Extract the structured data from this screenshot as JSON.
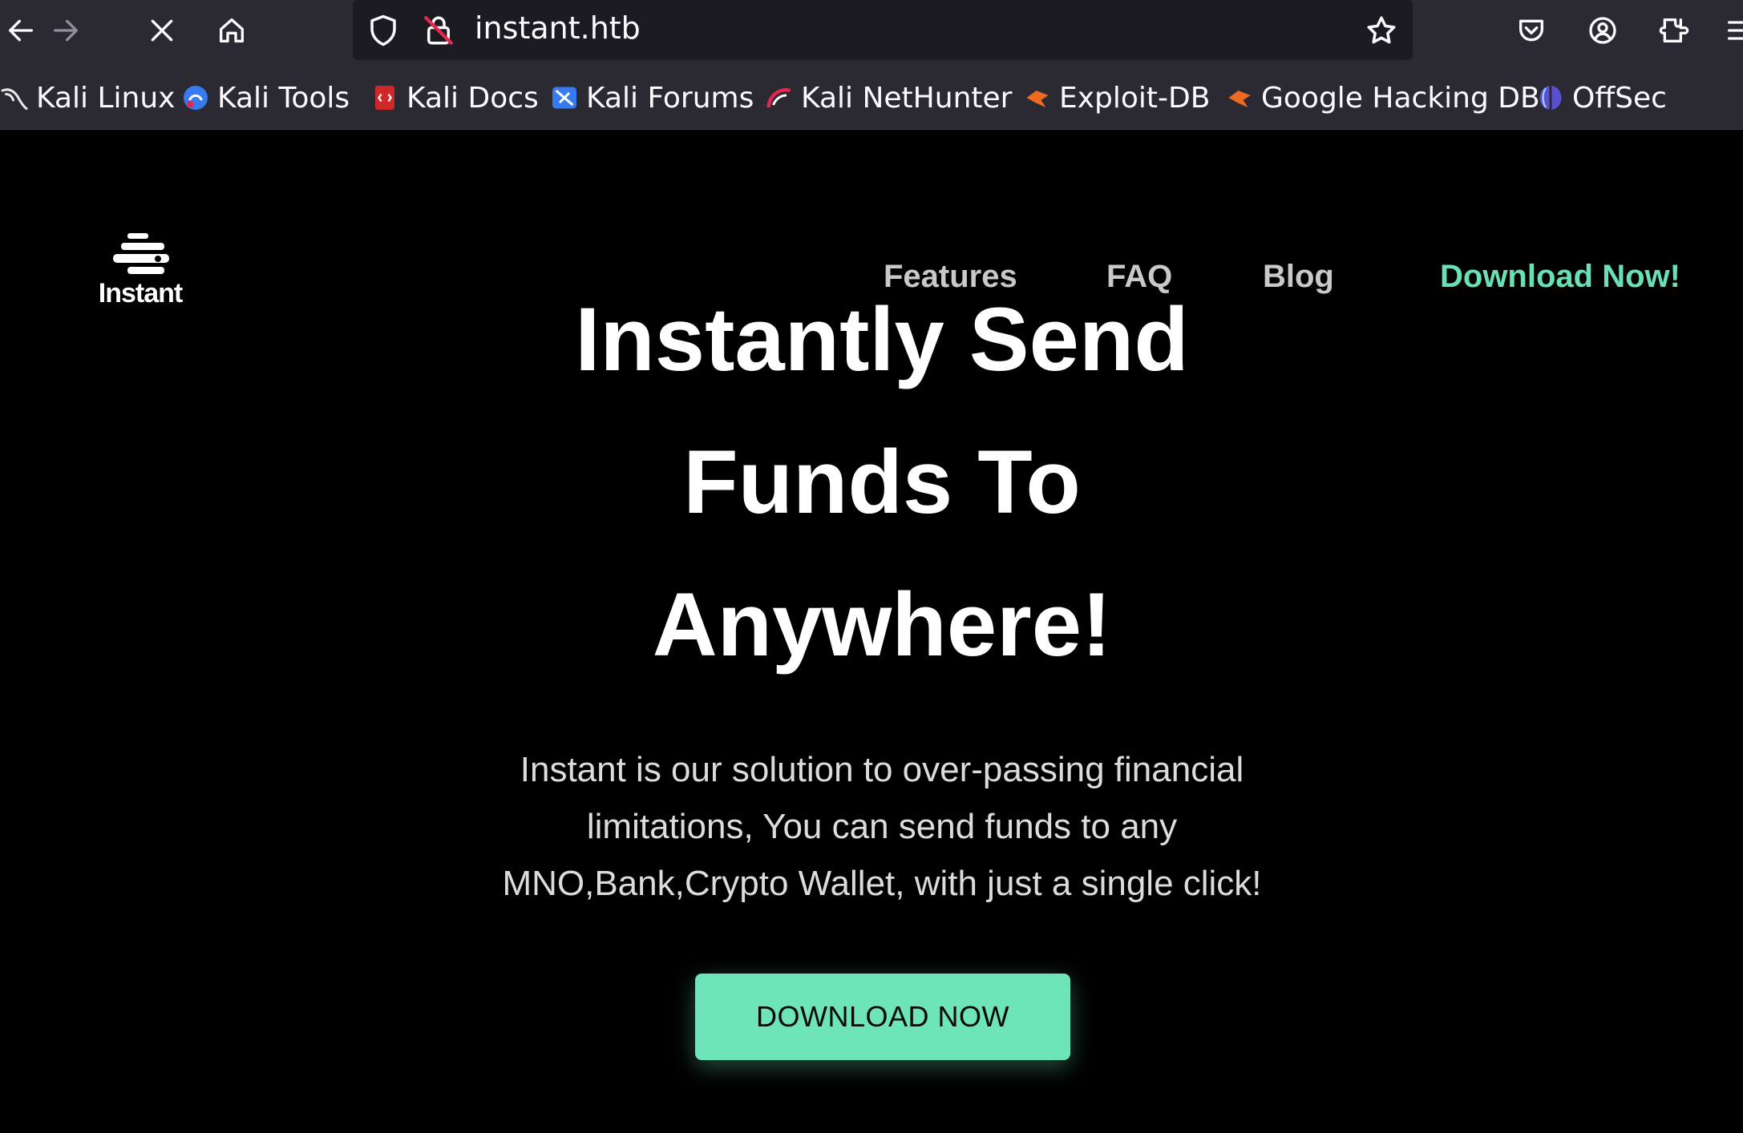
{
  "browser": {
    "url": "instant.htb",
    "toolbar_icons": [
      "back-arrow-icon",
      "forward-arrow-icon",
      "stop-loading-icon",
      "home-icon",
      "shield-icon",
      "insecure-lock-icon",
      "bookmark-star-icon",
      "pocket-icon",
      "account-icon",
      "extensions-icon",
      "menu-icon"
    ]
  },
  "bookmarks": [
    {
      "label": "Kali Linux",
      "icon": "kali-dragon-icon"
    },
    {
      "label": "Kali Tools",
      "icon": "kali-tools-icon"
    },
    {
      "label": "Kali Docs",
      "icon": "kali-docs-icon"
    },
    {
      "label": "Kali Forums",
      "icon": "kali-forums-icon"
    },
    {
      "label": "Kali NetHunter",
      "icon": "kali-nethunter-icon"
    },
    {
      "label": "Exploit-DB",
      "icon": "exploit-db-icon"
    },
    {
      "label": "Google Hacking DB",
      "icon": "ghdb-icon"
    },
    {
      "label": "OffSec",
      "icon": "offsec-icon"
    }
  ],
  "site": {
    "logo_text": "Instant",
    "nav": [
      {
        "label": "Features"
      },
      {
        "label": "FAQ"
      },
      {
        "label": "Blog"
      },
      {
        "label": "Download Now!"
      }
    ],
    "hero": {
      "title_lines": [
        "Instantly Send",
        "Funds To",
        "Anywhere!"
      ],
      "subtitle_lines": [
        "Instant is our solution to over-passing financial",
        "limitations, You can send funds to any",
        "MNO,Bank,Crypto Wallet, with just a single click!"
      ],
      "button_label": "DOWNLOAD NOW"
    }
  },
  "colors": {
    "accent": "#6ee4ba",
    "nav_cta": "#68e0b8",
    "page_background": "#000000",
    "browser_chrome": "#2b2a33",
    "urlbar": "#1c1b22"
  }
}
